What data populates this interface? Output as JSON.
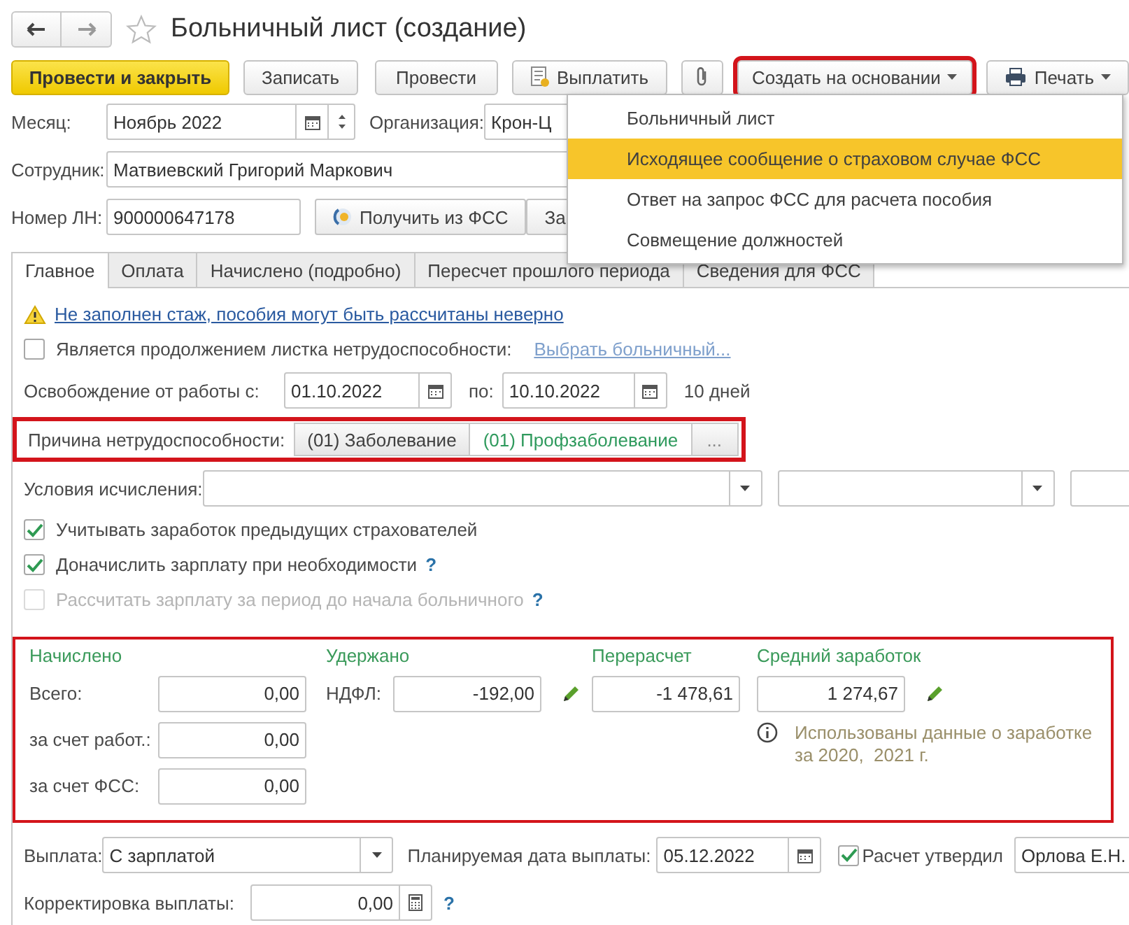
{
  "window": {
    "title": "Больничный лист (создание)",
    "favorite": false
  },
  "toolbar": [
    {
      "kind": "primary",
      "label": "Провести и закрыть"
    },
    {
      "kind": "plain",
      "label": "Записать"
    },
    {
      "kind": "plain",
      "label": "Провести"
    },
    {
      "kind": "document",
      "label": "Выплатить"
    },
    {
      "kind": "clip"
    },
    {
      "kind": "menu",
      "label": "Создать на основании",
      "highlighted": true
    },
    {
      "kind": "print",
      "label": "Печать"
    }
  ],
  "menu": [
    {
      "label": "Больничный лист",
      "selected": false
    },
    {
      "label": "Исходящее сообщение о страховом случае ФСС",
      "selected": true
    },
    {
      "label": "Ответ на запрос ФСС для расчета пособия",
      "selected": false
    },
    {
      "label": "Совмещение должностей",
      "selected": false
    }
  ],
  "header": {
    "month_label": "Месяц:",
    "month": "Ноябрь 2022",
    "org_label": "Организация:",
    "org": "Крон-Ц",
    "employee_label": "Сотрудник:",
    "employee": "Матвиевский Григорий Маркович",
    "number_label": "Номер ЛН:",
    "number": "900000647178",
    "fss_button": "Получить из ФСС",
    "fill_button": "За"
  },
  "tabs": [
    {
      "label": "Главное",
      "selected": true
    },
    {
      "label": "Оплата",
      "selected": false
    },
    {
      "label": "Начислено (подробно)",
      "selected": false
    },
    {
      "label": "Пересчет прошлого периода",
      "selected": false
    },
    {
      "label": "Сведения для ФСС",
      "selected": false
    }
  ],
  "warning": "Не заполнен стаж, пособия могут быть рассчитаны неверно",
  "continuation": {
    "label": "Является продолжением листка нетрудоспособности:",
    "checked": false,
    "link": "Выбрать больничный..."
  },
  "release": {
    "label": "Освобождение от работы с:",
    "from": "01.10.2022",
    "to_label": "по:",
    "to": "10.10.2022",
    "days": "10 дней"
  },
  "reason": {
    "label": "Причина нетрудоспособности:",
    "highlighted": true,
    "options": [
      {
        "label": "(01) Заболевание",
        "selected": false
      },
      {
        "label": "(01) Профзаболевание",
        "selected": true
      }
    ],
    "more": "..."
  },
  "conditions": {
    "label": "Условия исчисления:"
  },
  "checks": [
    {
      "label": "Учитывать заработок предыдущих страхователей",
      "checked": true,
      "disabled": false
    },
    {
      "label": "Доначислить зарплату при необходимости",
      "checked": true,
      "disabled": false,
      "help": "?"
    },
    {
      "label": "Рассчитать зарплату за период до начала больничного",
      "checked": false,
      "disabled": true,
      "help": "?"
    }
  ],
  "totals": {
    "highlighted": true,
    "accrued": {
      "title": "Начислено",
      "rows": [
        {
          "label": "Всего:",
          "value": "0,00"
        },
        {
          "label": "за счет работ.:",
          "value": "0,00"
        },
        {
          "label": "за счет ФСС:",
          "value": "0,00"
        }
      ]
    },
    "withheld": {
      "title": "Удержано",
      "label": "НДФЛ:",
      "value": "-192,00"
    },
    "recalc": {
      "title": "Перерасчет",
      "value": "-1 478,61"
    },
    "average": {
      "title": "Средний заработок",
      "value": "1 274,67",
      "note": "Использованы данные о заработке за 2020,  2021 г."
    }
  },
  "payment": {
    "label": "Выплата:",
    "value": "С зарплатой",
    "date_label": "Планируемая дата выплаты:",
    "date": "05.12.2022",
    "approved_label": "Расчет утвердил",
    "approved": true,
    "approver": "Орлова Е.Н.",
    "correction_label": "Корректировка выплаты:",
    "correction": "0,00",
    "help": "?"
  }
}
